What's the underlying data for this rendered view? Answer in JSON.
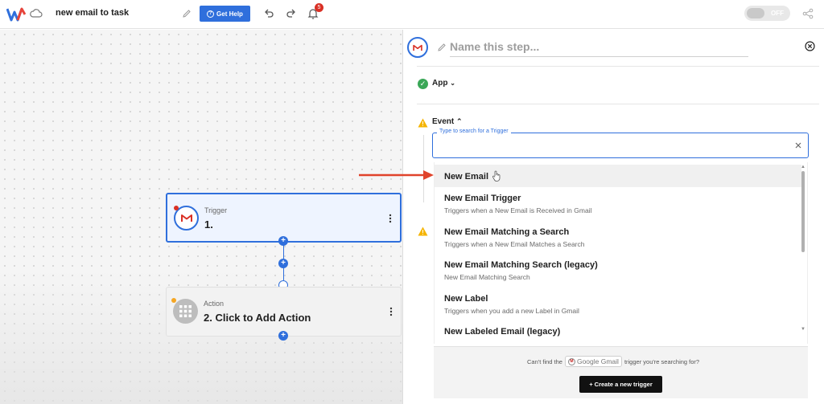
{
  "header": {
    "workflow_title": "new email to task",
    "help_label": "Get Help",
    "notification_count": "5",
    "toggle_label": "OFF"
  },
  "canvas": {
    "trigger_node": {
      "kind": "Trigger",
      "label": "1."
    },
    "action_node": {
      "kind": "Action",
      "label": "2. Click to Add Action"
    }
  },
  "panel": {
    "step_name_placeholder": "Name this step...",
    "app_section_label": "App",
    "event_section_label": "Event",
    "search_legend": "Type to search for a Trigger",
    "options": [
      {
        "title": "New Email",
        "desc": ""
      },
      {
        "title": "New Email Trigger",
        "desc": "Triggers when a New Email is Received in Gmail"
      },
      {
        "title": "New Email Matching a Search",
        "desc": "Triggers when a New Email Matches a Search"
      },
      {
        "title": "New Email Matching Search (legacy)",
        "desc": "New Email Matching Search"
      },
      {
        "title": "New Label",
        "desc": "Triggers when you add a new Label in Gmail"
      },
      {
        "title": "New Labeled Email (legacy)",
        "desc": ""
      }
    ],
    "footer": {
      "cant_find_prefix": "Can't find the",
      "app_chip": "Google Gmail",
      "cant_find_suffix": "trigger you're searching for?",
      "create_button": "+ Create a new trigger"
    }
  },
  "colors": {
    "accent": "#2f6fdc",
    "success": "#3aa757",
    "warning": "#f5b400",
    "annotation_arrow": "#e0432b"
  }
}
